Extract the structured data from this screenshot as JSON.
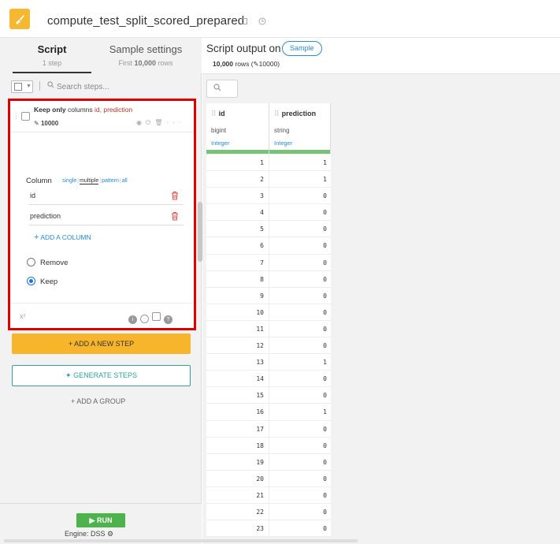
{
  "header": {
    "title": "compute_test_split_scored_prepared",
    "accent_color": "#f5b830"
  },
  "left_tabs": {
    "script": {
      "label": "Script",
      "sub": "1 step"
    },
    "sample": {
      "label": "Sample settings",
      "sub_prefix": "First",
      "sub_count": "10,000",
      "sub_suffix": "rows"
    }
  },
  "search": {
    "placeholder": "Search steps..."
  },
  "step": {
    "title_bold": "Keep only",
    "title_mid": "columns",
    "title_cols": "id, prediction",
    "sub": "10000",
    "column_label": "Column",
    "modes": [
      "single",
      "multiple",
      "pattern",
      "all"
    ],
    "selected_mode": "multiple",
    "columns": [
      "id",
      "prediction"
    ],
    "add_column": "ADD A COLUMN",
    "options": [
      {
        "label": "Remove",
        "selected": false
      },
      {
        "label": "Keep",
        "selected": true
      }
    ]
  },
  "actions": {
    "add_step": "ADD A NEW STEP",
    "generate_steps": "GENERATE STEPS",
    "add_group": "ADD A GROUP",
    "run": "RUN",
    "engine": "Engine: DSS"
  },
  "output": {
    "title": "Script output on",
    "sample_pill": "Sample",
    "rows_count": "10,000",
    "rows_label": "rows",
    "rows_edit": "10000"
  },
  "table": {
    "columns": [
      {
        "name": "id",
        "type": "bigint",
        "meaning": "Integer"
      },
      {
        "name": "prediction",
        "type": "string",
        "meaning": "Integer"
      }
    ],
    "rows": [
      [
        "1",
        "1"
      ],
      [
        "2",
        "1"
      ],
      [
        "3",
        "0"
      ],
      [
        "4",
        "0"
      ],
      [
        "5",
        "0"
      ],
      [
        "6",
        "0"
      ],
      [
        "7",
        "0"
      ],
      [
        "8",
        "0"
      ],
      [
        "9",
        "0"
      ],
      [
        "10",
        "0"
      ],
      [
        "11",
        "0"
      ],
      [
        "12",
        "0"
      ],
      [
        "13",
        "1"
      ],
      [
        "14",
        "0"
      ],
      [
        "15",
        "0"
      ],
      [
        "16",
        "1"
      ],
      [
        "17",
        "0"
      ],
      [
        "18",
        "0"
      ],
      [
        "19",
        "0"
      ],
      [
        "20",
        "0"
      ],
      [
        "21",
        "0"
      ],
      [
        "22",
        "0"
      ],
      [
        "23",
        "0"
      ]
    ]
  }
}
